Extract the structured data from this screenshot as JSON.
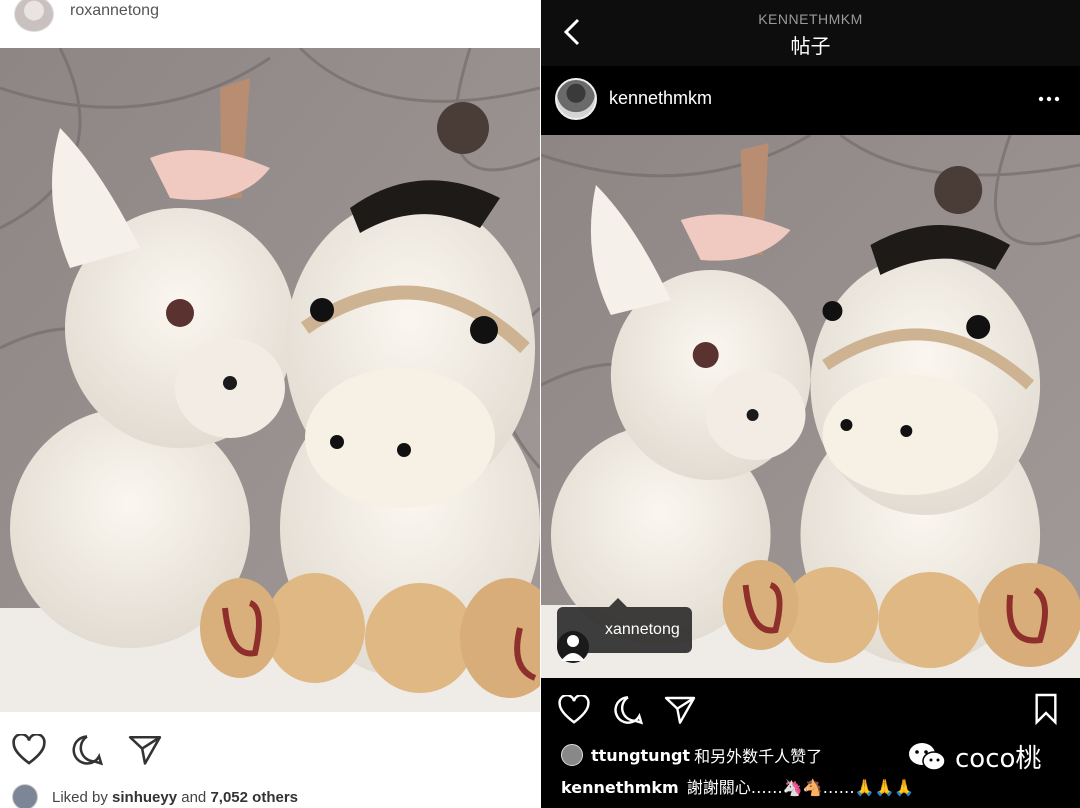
{
  "left": {
    "username": "roxannetong",
    "liked": {
      "prefix": "Liked by",
      "user": "sinhueyy",
      "middle": "and",
      "count": "7,052 others"
    }
  },
  "right": {
    "header_username": "KENNETHMKM",
    "header_title": "帖子",
    "username": "kennethmkm",
    "tag_label": "roxannetong",
    "tag_label_visible": "xannetong",
    "likes": {
      "user": "ttungtungt",
      "text": "和另外数千人赞了"
    },
    "caption": {
      "user": "kennethmkm",
      "text": "謝謝關心……🦄🐴……🙏🙏🙏"
    }
  },
  "watermark": {
    "text": "coco桃",
    "icon": "wechat-icon"
  },
  "icons": {
    "like": "heart-icon",
    "comment": "comment-bubble-icon",
    "share": "paper-plane-icon",
    "save": "bookmark-icon",
    "back": "chevron-left-icon",
    "more": "more-dots-icon",
    "tag": "person-tag-icon"
  }
}
